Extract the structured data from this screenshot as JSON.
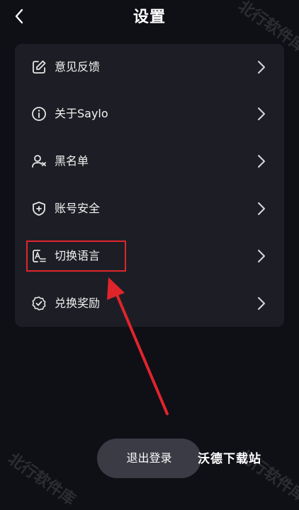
{
  "header": {
    "title": "设置",
    "back_icon": "chevron-left-icon"
  },
  "menu": {
    "items": [
      {
        "label": "意见反馈",
        "icon": "edit-icon"
      },
      {
        "label": "关于Saylo",
        "icon": "info-icon"
      },
      {
        "label": "黑名单",
        "icon": "user-block-icon"
      },
      {
        "label": "账号安全",
        "icon": "shield-plus-icon"
      },
      {
        "label": "切换语言",
        "icon": "language-icon"
      },
      {
        "label": "兑换奖励",
        "icon": "badge-check-icon"
      }
    ]
  },
  "logout": {
    "label": "退出登录"
  },
  "watermarks": {
    "site": "沃德下载站",
    "brand": "北行软件库"
  },
  "colors": {
    "background": "#0f0f16",
    "card": "#1d1e25",
    "button": "#3a3b44",
    "annotation": "#e0242c"
  }
}
